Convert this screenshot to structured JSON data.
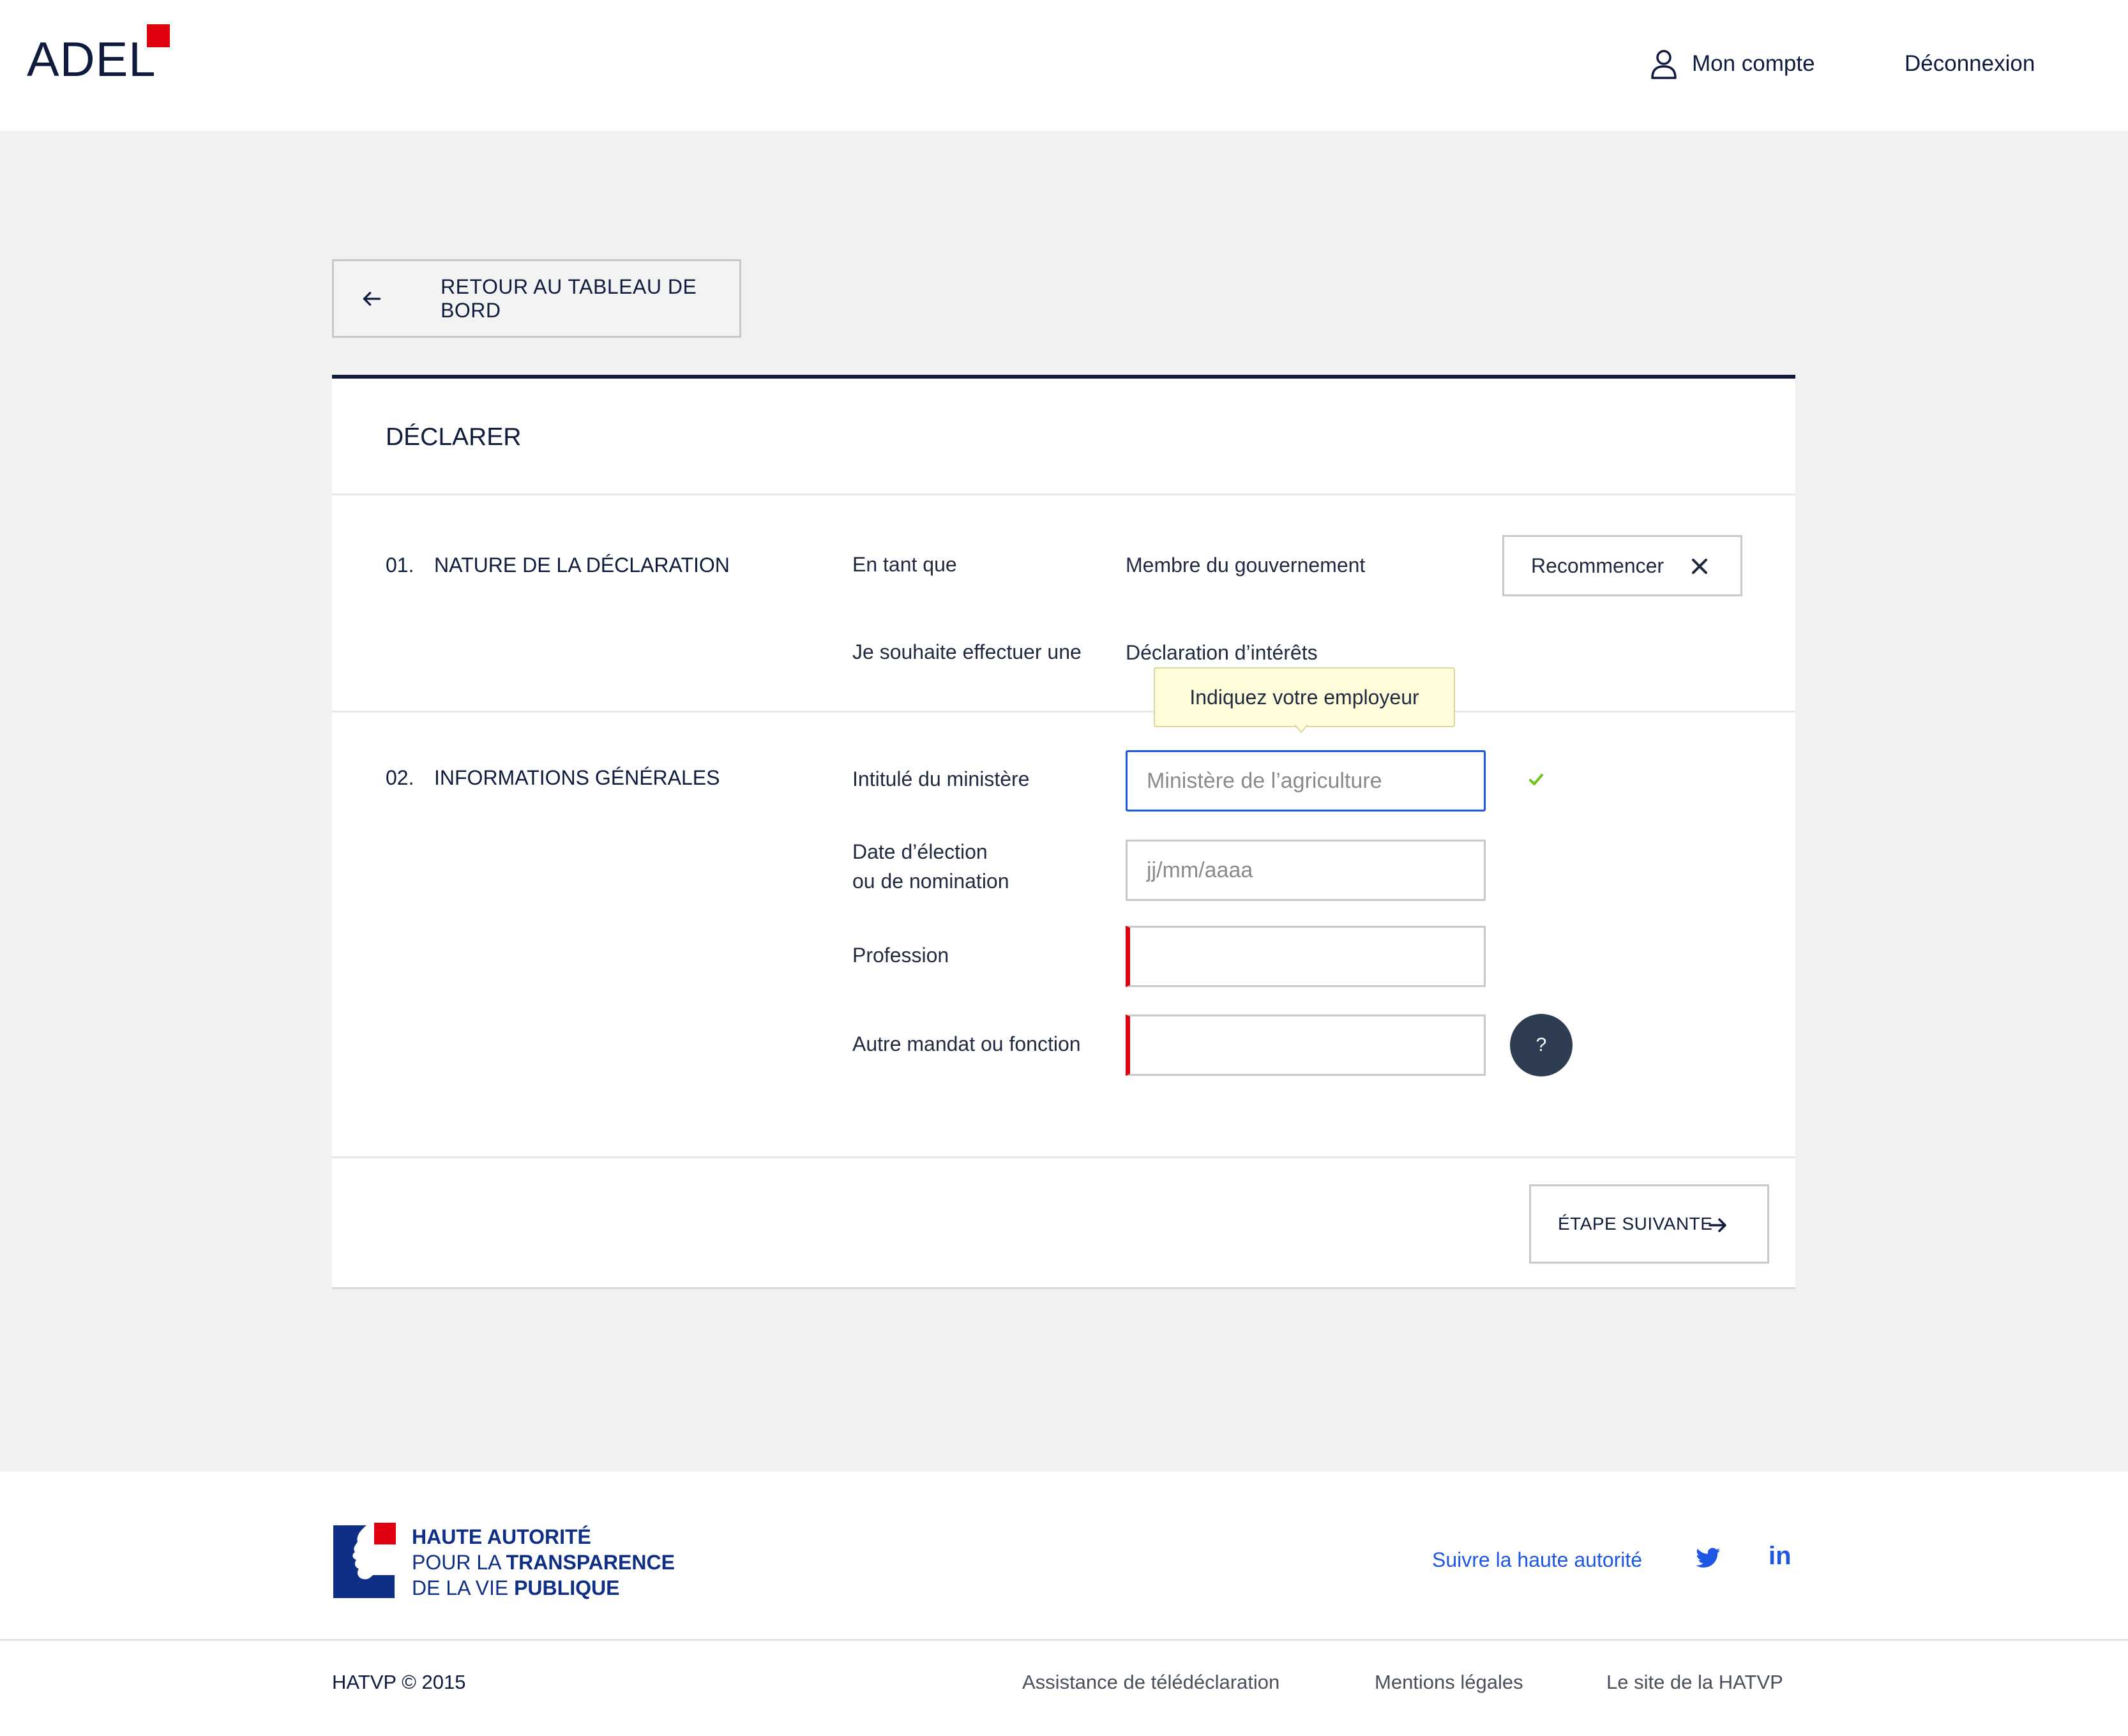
{
  "header": {
    "logo": "ADEL",
    "account_label": "Mon compte",
    "logout_label": "Déconnexion"
  },
  "back_button": {
    "label": "RETOUR AU TABLEAU DE BORD"
  },
  "card": {
    "title": "DÉCLARER",
    "section1": {
      "number": "01.",
      "title": "NATURE DE LA DÉCLARATION",
      "row1_label": "En tant que",
      "row1_value": "Membre du gouvernement",
      "row2_label": "Je souhaite effectuer une",
      "row2_value": "Déclaration d’intérêts",
      "restart_label": "Recommencer"
    },
    "section2": {
      "number": "02.",
      "title": "INFORMATIONS GÉNÉRALES",
      "tooltip": "Indiquez votre employeur",
      "ministry_label": "Intitulé du ministère",
      "ministry_value": "Ministère de l’agriculture",
      "date_label_line1": "Date d’élection",
      "date_label_line2": "ou de nomination",
      "date_placeholder": "jj/mm/aaaa",
      "profession_label": "Profession",
      "other_label": "Autre mandat ou fonction",
      "help_label": "?"
    },
    "next_label": "ÉTAPE SUIVANTE"
  },
  "footer": {
    "org_line1": "HAUTE AUTORITÉ",
    "org_line2_a": "POUR LA ",
    "org_line2_b": "TRANSPARENCE",
    "org_line3_a": "DE LA VIE ",
    "org_line3_b": "PUBLIQUE",
    "follow_label": "Suivre la haute autorité",
    "linkedin_label": "in",
    "copyright": "HATVP © 2015",
    "links": [
      "Assistance de télédéclaration",
      "Mentions légales",
      "Le site de la HATVP"
    ]
  },
  "colors": {
    "brand_navy": "#0f1b3d",
    "brand_red": "#e1000f",
    "link_blue": "#1d57e3",
    "focus_blue": "#1d57e3",
    "success_green": "#6cc417",
    "tooltip_bg": "#fefcd9"
  },
  "icons": [
    "user-icon",
    "arrow-left-icon",
    "close-icon",
    "check-icon",
    "arrow-right-icon",
    "twitter-icon",
    "linkedin-icon"
  ]
}
